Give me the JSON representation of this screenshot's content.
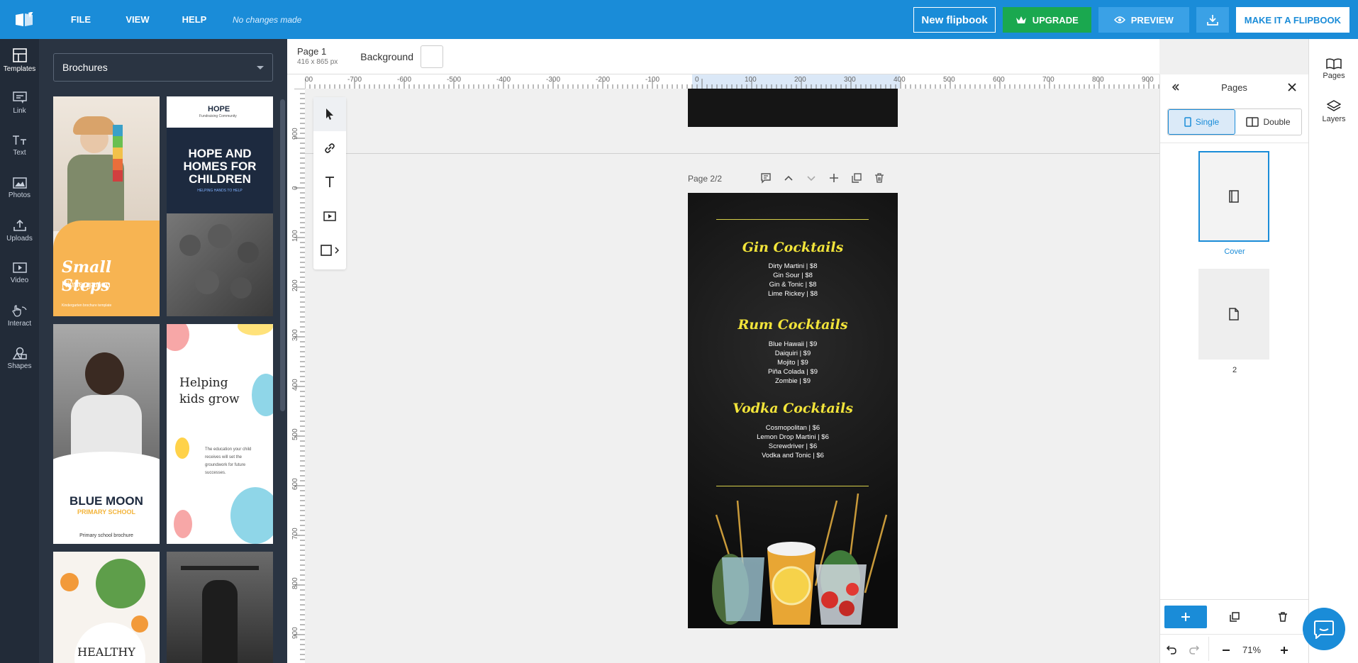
{
  "topbar": {
    "menu": [
      "FILE",
      "VIEW",
      "HELP"
    ],
    "status": "No changes made",
    "new_flipbook": "New flipbook",
    "upgrade": "UPGRADE",
    "preview": "PREVIEW",
    "make_flipbook": "MAKE IT A FLIPBOOK"
  },
  "leftnav": [
    "Templates",
    "Link",
    "Text",
    "Photos",
    "Uploads",
    "Video",
    "Interact",
    "Shapes"
  ],
  "templates": {
    "category": "Brochures",
    "cards": {
      "small_steps": {
        "title": "Small Steps",
        "subtitle": "Kindergarten",
        "caption": "Kindergarten brochure template"
      },
      "hope": {
        "logo": "HOPE",
        "logo_sub": "Fundraising Community",
        "title": "HOPE AND HOMES FOR CHILDREN",
        "tagline": "HELPING HANDS TO HELP"
      },
      "blue_moon": {
        "title": "BLUE MOON",
        "subtitle": "PRIMARY SCHOOL",
        "caption": "Primary school brochure"
      },
      "helping": {
        "title": "Helping kids grow",
        "body": "The education your child receives will set the groundwork for future successes."
      },
      "healthy": {
        "title": "HEALTHY"
      }
    }
  },
  "doc": {
    "page_title": "Page 1",
    "page_size": "416 x 865 px",
    "background_label": "Background",
    "page_label": "Page 2/2"
  },
  "ruler": {
    "h_ticks": [
      "00",
      "-700",
      "-600",
      "-500",
      "-400",
      "-300",
      "-200",
      "-100",
      "0",
      "100",
      "200",
      "300",
      "400",
      "500",
      "600",
      "700",
      "800",
      "900"
    ],
    "v_ticks": [
      "900",
      "0",
      "100",
      "200",
      "300",
      "400",
      "500",
      "600",
      "700",
      "800",
      "900"
    ]
  },
  "menu_page": {
    "sections": [
      {
        "title": "Gin Cocktails",
        "items": [
          "Dirty Martini | $8",
          "Gin Sour | $8",
          "Gin & Tonic | $8",
          "Lime Rickey | $8"
        ]
      },
      {
        "title": "Rum Cocktails",
        "items": [
          "Blue Hawaii | $9",
          "Daiquiri | $9",
          "Mojito | $9",
          "Piña Colada | $9",
          "Zombie | $9"
        ]
      },
      {
        "title": "Vodka Cocktails",
        "items": [
          "Cosmopolitan | $6",
          "Lemon Drop Martini | $6",
          "Screwdriver | $6",
          "Vodka and Tonic | $6"
        ]
      }
    ]
  },
  "pages_panel": {
    "title": "Pages",
    "single": "Single",
    "double": "Double",
    "pages": [
      "Cover",
      "2"
    ],
    "zoom": "71%"
  },
  "far_right": [
    "Pages",
    "Layers"
  ],
  "colors": {
    "brand": "#1a8cd8",
    "menu_title": "#f2e43a",
    "upgrade": "#1aa84f"
  }
}
